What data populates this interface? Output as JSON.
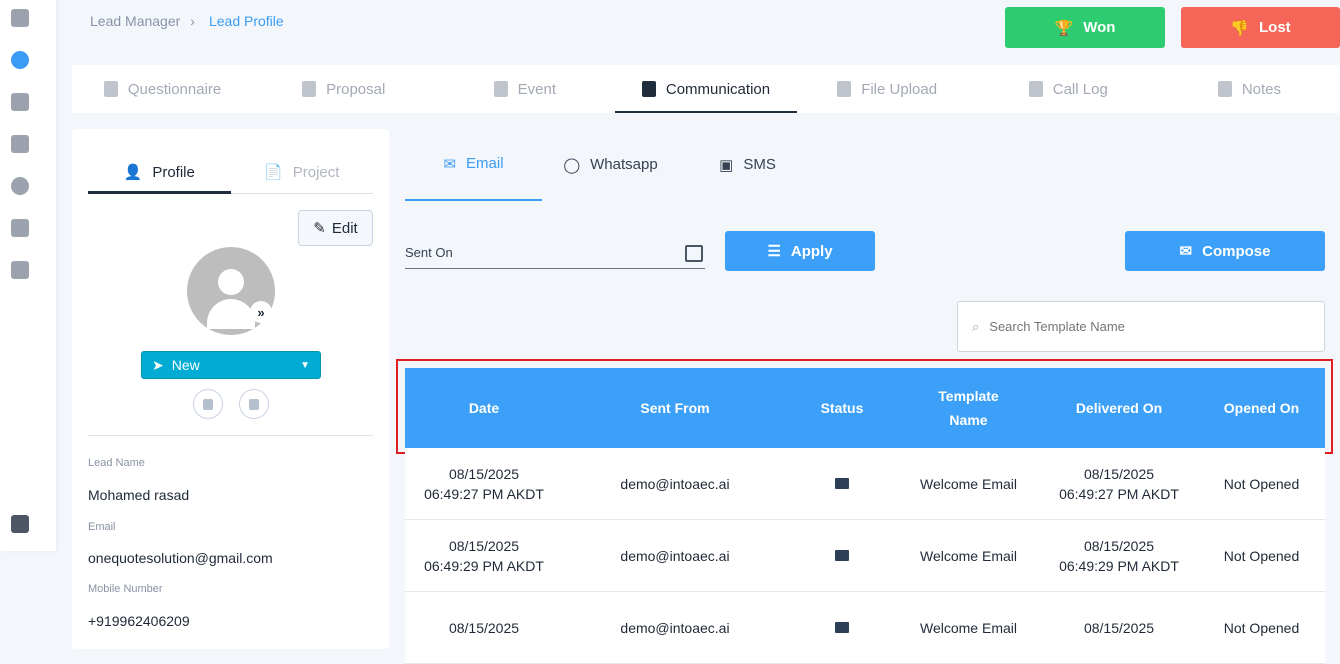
{
  "breadcrumb": {
    "parent": "Lead Manager",
    "current": "Lead Profile"
  },
  "actions": {
    "won": "Won",
    "lost": "Lost"
  },
  "top_tabs": [
    {
      "label": "Questionnaire"
    },
    {
      "label": "Proposal"
    },
    {
      "label": "Event"
    },
    {
      "label": "Communication",
      "active": true
    },
    {
      "label": "File Upload"
    },
    {
      "label": "Call Log"
    },
    {
      "label": "Notes"
    }
  ],
  "profile": {
    "tabs": [
      "Profile",
      "Project"
    ],
    "edit": "Edit",
    "status": "New",
    "fields": [
      {
        "label": "Lead Name",
        "value": "Mohamed rasad"
      },
      {
        "label": "Email",
        "value": "onequotesolution@gmail.com"
      },
      {
        "label": "Mobile Number",
        "value": "+919962406209"
      }
    ]
  },
  "channels": [
    "Email",
    "Whatsapp",
    "SMS"
  ],
  "filter": {
    "sent_on": "Sent On",
    "apply": "Apply",
    "compose": "Compose",
    "search_placeholder": "Search Template Name"
  },
  "table": {
    "headers": [
      "Date",
      "Sent From",
      "Status",
      "Template Name",
      "Delivered On",
      "Opened On"
    ],
    "rows": [
      {
        "date": "08/15/2025",
        "time": "06:49:27 PM AKDT",
        "from": "demo@intoaec.ai",
        "template": "Welcome Email",
        "del_date": "08/15/2025",
        "del_time": "06:49:27 PM AKDT",
        "opened": "Not Opened"
      },
      {
        "date": "08/15/2025",
        "time": "06:49:29 PM AKDT",
        "from": "demo@intoaec.ai",
        "template": "Welcome Email",
        "del_date": "08/15/2025",
        "del_time": "06:49:29 PM AKDT",
        "opened": "Not Opened"
      },
      {
        "date": "08/15/2025",
        "time": "",
        "from": "demo@intoaec.ai",
        "template": "Welcome Email",
        "del_date": "08/15/2025",
        "del_time": "",
        "opened": "Not Opened"
      }
    ]
  }
}
